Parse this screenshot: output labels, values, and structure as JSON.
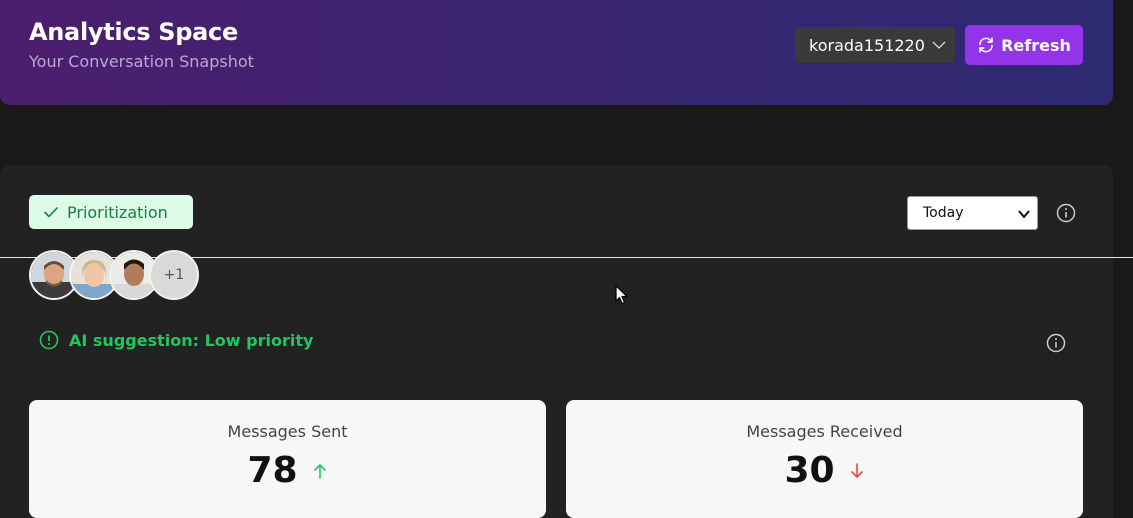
{
  "header": {
    "title": "Analytics Space",
    "subtitle": "Your Conversation Snapshot",
    "account": "korada151220",
    "refresh_label": "Refresh"
  },
  "panel": {
    "badge_label": "Prioritization",
    "period": "Today",
    "more_participants": "+1",
    "ai_suggestion": "AI suggestion: Low priority"
  },
  "stats": [
    {
      "label": "Messages Sent",
      "value": "78",
      "trend": "up",
      "trend_color": "#22c55e"
    },
    {
      "label": "Messages Received",
      "value": "30",
      "trend": "down",
      "trend_color": "#ef4444"
    }
  ],
  "colors": {
    "accent": "#9333ea",
    "success": "#22c55e",
    "badge_bg": "#dcfce7",
    "badge_text": "#15803d"
  }
}
